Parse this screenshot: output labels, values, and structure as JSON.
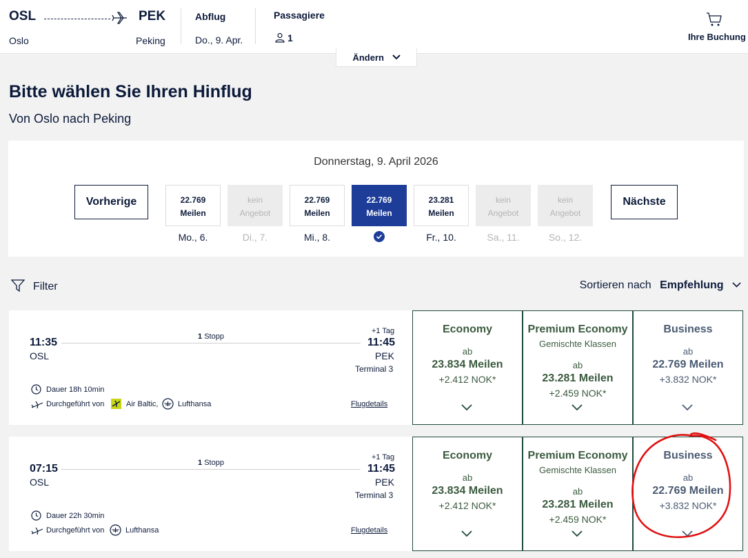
{
  "header": {
    "origin_code": "OSL",
    "origin_city": "Oslo",
    "dest_code": "PEK",
    "dest_city": "Peking",
    "departure_label": "Abflug",
    "departure_value": "Do., 9. Apr.",
    "passengers_label": "Passagiere",
    "passengers_value": "1",
    "cart_label": "Ihre Buchung",
    "change_label": "Ändern"
  },
  "page": {
    "title": "Bitte wählen Sie Ihren Hinflug",
    "subtitle": "Von Oslo nach Peking"
  },
  "date_picker": {
    "selected_date": "Donnerstag, 9. April 2026",
    "prev_label": "Vorherige",
    "next_label": "Nächste",
    "days": [
      {
        "line1": "22.769",
        "line2": "Meilen",
        "label": "Mo., 6.",
        "state": "available"
      },
      {
        "line1": "kein",
        "line2": "Angebot",
        "label": "Di., 7.",
        "state": "none"
      },
      {
        "line1": "22.769",
        "line2": "Meilen",
        "label": "Mi., 8.",
        "state": "available"
      },
      {
        "line1": "22.769",
        "line2": "Meilen",
        "label": "",
        "state": "selected"
      },
      {
        "line1": "23.281",
        "line2": "Meilen",
        "label": "Fr., 10.",
        "state": "available"
      },
      {
        "line1": "kein",
        "line2": "Angebot",
        "label": "Sa., 11.",
        "state": "none"
      },
      {
        "line1": "kein",
        "line2": "Angebot",
        "label": "So., 12.",
        "state": "none"
      }
    ]
  },
  "toolbar": {
    "filter_label": "Filter",
    "sort_prefix": "Sortieren nach",
    "sort_value": "Empfehlung"
  },
  "flights": [
    {
      "dep_time": "11:35",
      "dep_airport": "OSL",
      "arr_time": "11:45",
      "arr_airport": "PEK",
      "arr_terminal": "Terminal 3",
      "plus_day": "+1 Tag",
      "stops_count": "1",
      "stops_label": "Stopp",
      "duration": "Dauer 18h 10min",
      "operated_prefix": "Durchgeführt von",
      "carrier1": "Air Baltic,",
      "carrier2": "Lufthansa",
      "details_label": "Flugdetails",
      "fares": {
        "economy": {
          "cls": "Economy",
          "ab": "ab",
          "miles": "23.834 Meilen",
          "nok": "+2.412 NOK*"
        },
        "premium": {
          "cls": "Premium Economy",
          "sub": "Gemischte Klassen",
          "ab": "ab",
          "miles": "23.281 Meilen",
          "nok": "+2.459 NOK*"
        },
        "business": {
          "cls": "Business",
          "ab": "ab",
          "miles": "22.769 Meilen",
          "nok": "+3.832 NOK*"
        }
      }
    },
    {
      "dep_time": "07:15",
      "dep_airport": "OSL",
      "arr_time": "11:45",
      "arr_airport": "PEK",
      "arr_terminal": "Terminal 3",
      "plus_day": "+1 Tag",
      "stops_count": "1",
      "stops_label": "Stopp",
      "duration": "Dauer 22h 30min",
      "operated_prefix": "Durchgeführt von",
      "carrier1": "Lufthansa",
      "details_label": "Flugdetails",
      "fares": {
        "economy": {
          "cls": "Economy",
          "ab": "ab",
          "miles": "23.834 Meilen",
          "nok": "+2.412 NOK*"
        },
        "premium": {
          "cls": "Premium Economy",
          "sub": "Gemischte Klassen",
          "ab": "ab",
          "miles": "23.281 Meilen",
          "nok": "+2.459 NOK*"
        },
        "business": {
          "cls": "Business",
          "ab": "ab",
          "miles": "22.769 Meilen",
          "nok": "+3.832 NOK*"
        }
      }
    }
  ],
  "colors": {
    "brand_navy": "#0c1a3a",
    "selected_blue": "#1d3d99",
    "fare_green": "#3a5a3e",
    "annotation_red": "#e01010"
  }
}
